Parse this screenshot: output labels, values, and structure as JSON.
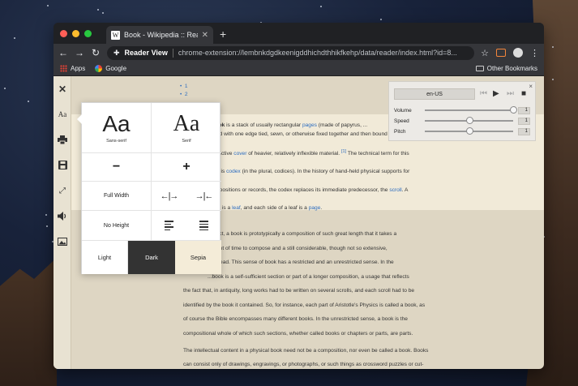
{
  "browser": {
    "tab_title": "Book - Wikipedia :: Reader View",
    "tab_favicon": "W",
    "reader_view_label": "Reader View",
    "url": "chrome-extension://lembnkdgdkeenigddhichdthhikfkehp/data/reader/index.html?id=8...",
    "bookmarks": {
      "apps": "Apps",
      "google": "Google",
      "other": "Other Bookmarks"
    }
  },
  "sidebar_icons": [
    "close-icon",
    "font-size-icon",
    "print-icon",
    "save-icon",
    "fullscreen-icon",
    "speaker-icon",
    "image-icon"
  ],
  "style_popup": {
    "font_sans": {
      "glyph": "Aa",
      "label": "Sans-serif"
    },
    "font_serif": {
      "glyph": "Aa",
      "label": "Serif"
    },
    "decrease": "−",
    "increase": "+",
    "full_width": "Full Width",
    "widen_symbol": "←|→",
    "narrow_symbol": "→|←",
    "no_height": "No Height",
    "themes": {
      "light": "Light",
      "dark": "Dark",
      "sepia": "Sepia"
    }
  },
  "tts": {
    "language": "en-US",
    "volume_label": "Volume",
    "volume_value": "1",
    "volume_level": 1.0,
    "speed_label": "Speed",
    "speed_value": "1",
    "speed_level": 0.5,
    "pitch_label": "Pitch",
    "pitch_value": "1",
    "pitch_level": 0.5
  },
  "article": {
    "bullets": [
      "1",
      "2"
    ],
    "p1_parts": {
      "a": "a",
      "book": "book",
      "b": "is a stack of usually rectangular",
      "pages": "pages",
      "c": "(made of papyrus, ...",
      "line2": "...nted with one edge tied, sewn, or otherwise fixed together and then bound to the",
      "line3a": "...rotective",
      "cover": "cover",
      "line3b": "of heavier, relatively inflexible material.",
      "ref": "[1]",
      "line3c": "The technical term for this",
      "line4a": "...ent is",
      "codex": "codex",
      "line4b": "(in the plural, codices). In the history of hand-held physical supports for",
      "line5a": "...ompositions or records, the codex replaces its immediate predecessor, the",
      "scroll": "scroll",
      "line5b": ". A",
      "line6a": "...dex is a",
      "leaf": "leaf",
      "line6b": ", and each side of a leaf is a",
      "page": "page",
      "line6c": "."
    },
    "p2": [
      "...bject, a book is prototypically a composition of such great length that it takes a",
      "...ment of time to compose and a still considerable, though not so extensive,",
      "...to read. This sense of book has a restricted and an unrestricted sense. In the",
      "...book is a self-sufficient section or part of a longer composition, a usage that reflects",
      "the fact that, in antiquity, long works had to be written on several scrolls, and each scroll had to be",
      "identified by the book it contained. So, for instance, each part of Aristotle's Physics is called a book, as",
      "of course the Bible encompasses many different books. In the unrestricted sense, a book is the",
      "compositional whole of which such sections, whether called books or chapters or parts, are parts."
    ],
    "p3": [
      "The intellectual content in a physical book need not be a composition, nor even be called a book. Books",
      "can consist only of drawings, engravings, or photographs, or such things as crossword puzzles or cut-"
    ]
  }
}
